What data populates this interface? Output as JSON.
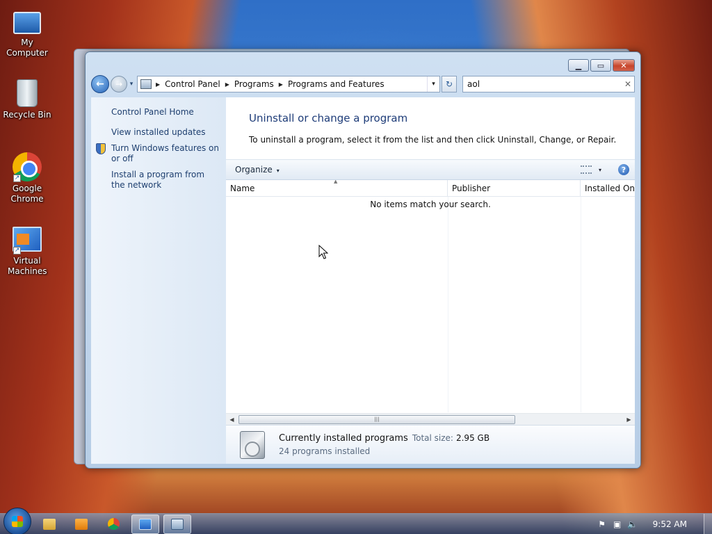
{
  "desktop": {
    "icons": [
      {
        "label": "My Computer",
        "icon": "computer-icon"
      },
      {
        "label": "Recycle Bin",
        "icon": "recycle-bin-icon"
      },
      {
        "label": "Google Chrome",
        "icon": "chrome-icon"
      },
      {
        "label": "Virtual Machines",
        "icon": "virtual-machines-icon"
      }
    ]
  },
  "window": {
    "controls": {
      "minimize": "▁",
      "maximize": "▭",
      "close": "✕"
    },
    "nav": {
      "back": "←",
      "forward": "→",
      "history": "▾"
    },
    "address": {
      "crumbs": [
        "Control Panel",
        "Programs",
        "Programs and Features"
      ],
      "separator": "▶",
      "dropdown": "▾",
      "refresh": "↻"
    },
    "search": {
      "value": "aol",
      "clear": "✕"
    },
    "left_pane": {
      "home": "Control Panel Home",
      "links": [
        "View installed updates",
        "Turn Windows features on or off",
        "Install a program from the network"
      ]
    },
    "main": {
      "title": "Uninstall or change a program",
      "description": "To uninstall a program, select it from the list and then click Uninstall, Change, or Repair.",
      "toolbar": {
        "organize": "Organize",
        "caret": "▾",
        "help": "?"
      },
      "columns": [
        "Name",
        "Publisher",
        "Installed On"
      ],
      "sort_indicator": "▲",
      "empty_message": "No items match your search.",
      "scroll": {
        "left": "◀",
        "right": "▶",
        "grip": "|||"
      }
    },
    "details": {
      "title": "Currently installed programs",
      "size_label": "Total size:",
      "size_value": "2.95 GB",
      "count": "24 programs installed"
    }
  },
  "taskbar": {
    "apps": [
      {
        "name": "explorer",
        "icon": "folder-icon",
        "active": false
      },
      {
        "name": "media-player",
        "icon": "media-player-icon",
        "active": false
      },
      {
        "name": "chrome",
        "icon": "chrome-icon",
        "active": false
      },
      {
        "name": "virtual-machines",
        "icon": "virtual-machines-icon",
        "active": true
      },
      {
        "name": "control-panel",
        "icon": "control-panel-icon",
        "active": true
      }
    ],
    "tray": {
      "flag": "⚑",
      "network": "▣",
      "volume": "🔈",
      "time": "9:52 AM"
    }
  },
  "colors": {
    "link": "#1e3f6f",
    "title": "#1e3c78",
    "close_button": "#c7452b"
  }
}
